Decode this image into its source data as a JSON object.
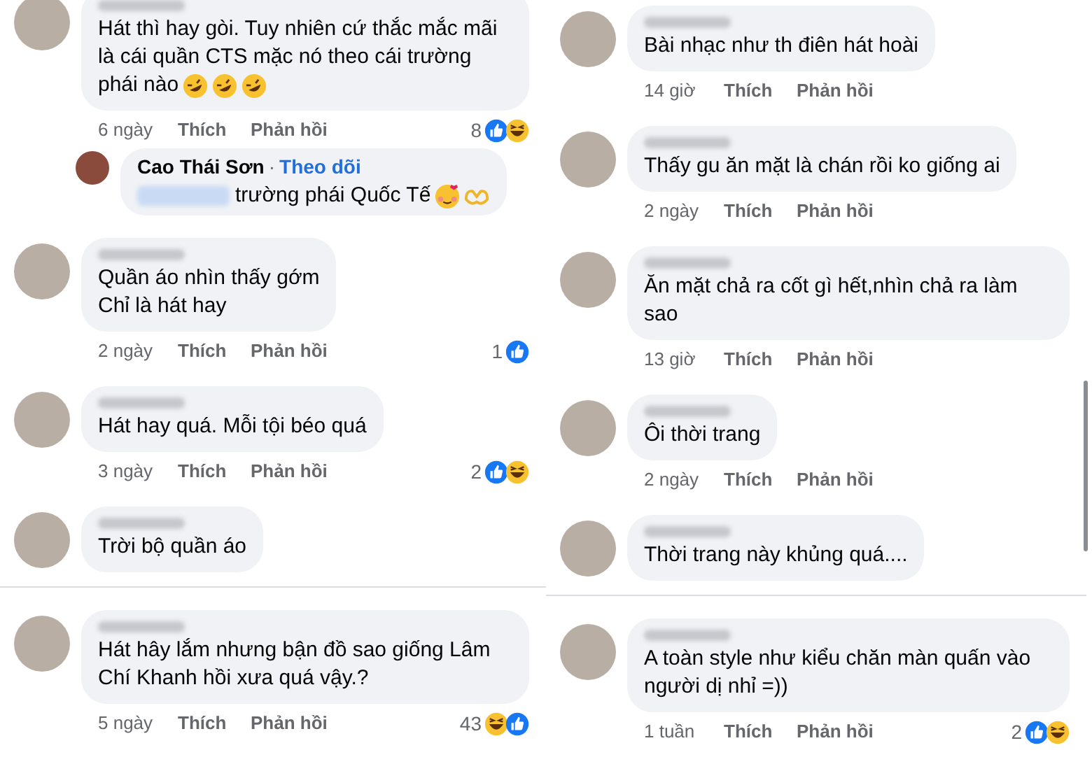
{
  "columns": [
    {
      "comments": [
        {
          "text": "Hát thì hay gòi. Tuy nhiên cứ thắc mắc mãi là cái quần CTS mặc nó theo cái trường phái nào",
          "emojis": [
            {
              "kind": "rofl"
            },
            {
              "kind": "rofl"
            },
            {
              "kind": "rofl"
            }
          ],
          "time": "6 ngày",
          "like": "Thích",
          "reply": "Phản hồi",
          "reaction_count": "8",
          "reactions": [
            {
              "kind": "like"
            },
            {
              "kind": "haha"
            }
          ],
          "replies": [
            {
              "author": "Cao Thái Sơn",
              "separator": "·",
              "follow": "Theo dõi",
              "mention": true,
              "text": "trường phái Quốc Tế",
              "emojis": [
                {
                  "kind": "love"
                },
                {
                  "kind": "hands"
                }
              ]
            }
          ]
        },
        {
          "text": "Quần áo nhìn thấy gớm\nChỉ là hát hay",
          "time": "2 ngày",
          "like": "Thích",
          "reply": "Phản hồi",
          "reaction_count": "1",
          "reactions": [
            {
              "kind": "like"
            }
          ]
        },
        {
          "text": "Hát hay quá. Mỗi tội béo quá",
          "time": "3 ngày",
          "like": "Thích",
          "reply": "Phản hồi",
          "reaction_count": "2",
          "reactions": [
            {
              "kind": "like"
            },
            {
              "kind": "haha"
            }
          ]
        },
        {
          "text": "Trời bộ quần áo",
          "divider_after": true
        },
        {
          "text": "Hát hây lắm nhưng bận đồ sao giống Lâm Chí Khanh hồi xưa quá vậy.?",
          "time": "5 ngày",
          "like": "Thích",
          "reply": "Phản hồi",
          "reaction_count": "43",
          "reactions": [
            {
              "kind": "haha"
            },
            {
              "kind": "like"
            }
          ]
        }
      ]
    },
    {
      "comments": [
        {
          "text": "Bài nhạc như th điên hát hoài",
          "time": "14 giờ",
          "like": "Thích",
          "reply": "Phản hồi"
        },
        {
          "text": "Thấy gu ăn mặt là chán rồi ko giống ai",
          "time": "2 ngày",
          "like": "Thích",
          "reply": "Phản hồi"
        },
        {
          "text": "Ăn mặt chả ra cốt gì hết,nhìn chả ra làm sao",
          "time": "13 giờ",
          "like": "Thích",
          "reply": "Phản hồi"
        },
        {
          "text": "Ôi thời trang",
          "time": "2 ngày",
          "like": "Thích",
          "reply": "Phản hồi"
        },
        {
          "text": "Thời trang này khủng quá....",
          "divider_after": true
        },
        {
          "text": "A toàn style như kiểu chăn màn quấn vào người dị nhỉ =))",
          "time": "1 tuần",
          "like": "Thích",
          "reply": "Phản hồi",
          "reaction_count": "2",
          "reactions": [
            {
              "kind": "like"
            },
            {
              "kind": "haha"
            }
          ]
        }
      ]
    }
  ]
}
